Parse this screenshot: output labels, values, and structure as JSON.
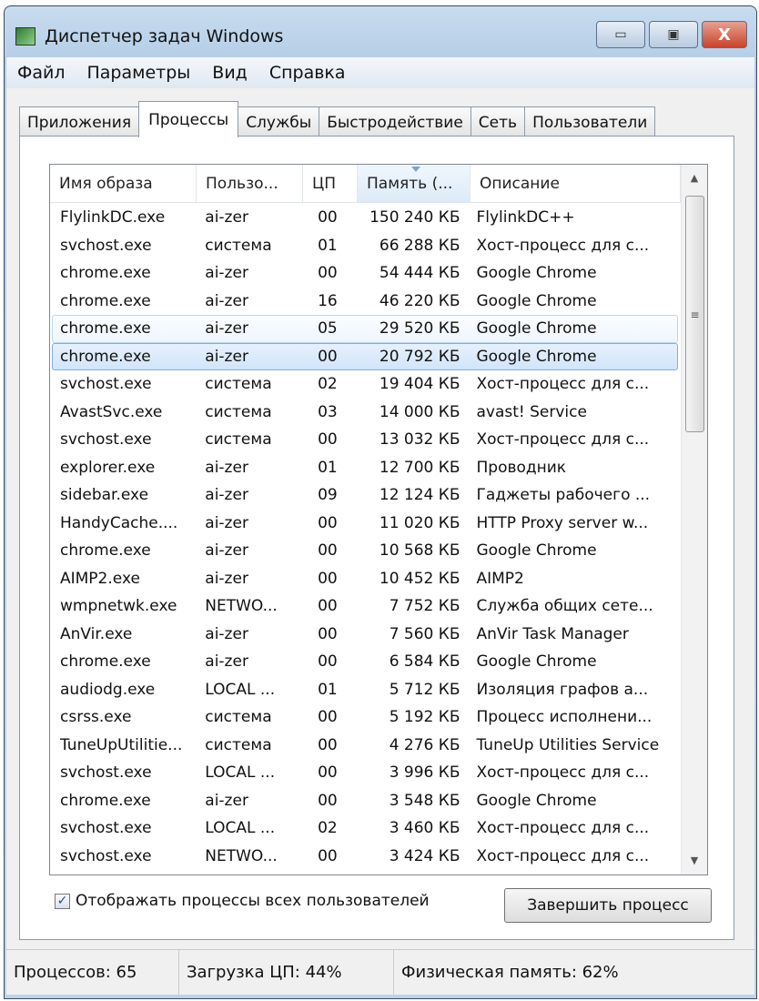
{
  "window": {
    "title": "Диспетчер задач Windows",
    "minimize": "▭",
    "maximize": "▣",
    "close": "X"
  },
  "menu": [
    "Файл",
    "Параметры",
    "Вид",
    "Справка"
  ],
  "tabs": [
    "Приложения",
    "Процессы",
    "Службы",
    "Быстродействие",
    "Сеть",
    "Пользователи"
  ],
  "columns": [
    "Имя образа",
    "Пользо...",
    "ЦП",
    "Память (...",
    "Описание"
  ],
  "rows": [
    [
      "FlylinkDC.exe",
      "ai-zer",
      "00",
      "150 240 КБ",
      "FlylinkDC++"
    ],
    [
      "svchost.exe",
      "система",
      "01",
      "66 288 КБ",
      "Хост-процесс для с..."
    ],
    [
      "chrome.exe",
      "ai-zer",
      "00",
      "54 444 КБ",
      "Google Chrome"
    ],
    [
      "chrome.exe",
      "ai-zer",
      "16",
      "46 220 КБ",
      "Google Chrome"
    ],
    [
      "chrome.exe",
      "ai-zer",
      "05",
      "29 520 КБ",
      "Google Chrome"
    ],
    [
      "chrome.exe",
      "ai-zer",
      "00",
      "20 792 КБ",
      "Google Chrome"
    ],
    [
      "svchost.exe",
      "система",
      "02",
      "19 404 КБ",
      "Хост-процесс для с..."
    ],
    [
      "AvastSvc.exe",
      "система",
      "03",
      "14 000 КБ",
      "avast! Service"
    ],
    [
      "svchost.exe",
      "система",
      "00",
      "13 032 КБ",
      "Хост-процесс для с..."
    ],
    [
      "explorer.exe",
      "ai-zer",
      "01",
      "12 700 КБ",
      "Проводник"
    ],
    [
      "sidebar.exe",
      "ai-zer",
      "09",
      "12 124 КБ",
      "Гаджеты рабочего ..."
    ],
    [
      "HandyCache....",
      "ai-zer",
      "00",
      "11 020 КБ",
      "HTTP Proxy server w..."
    ],
    [
      "chrome.exe",
      "ai-zer",
      "00",
      "10 568 КБ",
      "Google Chrome"
    ],
    [
      "AIMP2.exe",
      "ai-zer",
      "00",
      "10 452 КБ",
      "AIMP2"
    ],
    [
      "wmpnetwk.exe",
      "NETWO...",
      "00",
      "7 752 КБ",
      "Служба общих сете..."
    ],
    [
      "AnVir.exe",
      "ai-zer",
      "00",
      "7 560 КБ",
      "AnVir Task Manager"
    ],
    [
      "chrome.exe",
      "ai-zer",
      "00",
      "6 584 КБ",
      "Google Chrome"
    ],
    [
      "audiodg.exe",
      "LOCAL ...",
      "01",
      "5 712 КБ",
      "Изоляция графов а..."
    ],
    [
      "csrss.exe",
      "система",
      "00",
      "5 192 КБ",
      "Процесс исполнени..."
    ],
    [
      "TuneUpUtilitie...",
      "система",
      "00",
      "4 276 КБ",
      "TuneUp Utilities Service"
    ],
    [
      "svchost.exe",
      "LOCAL ...",
      "00",
      "3 996 КБ",
      "Хост-процесс для с..."
    ],
    [
      "chrome.exe",
      "ai-zer",
      "00",
      "3 548 КБ",
      "Google Chrome"
    ],
    [
      "svchost.exe",
      "LOCAL ...",
      "02",
      "3 460 КБ",
      "Хост-процесс для с..."
    ],
    [
      "svchost.exe",
      "NETWO...",
      "00",
      "3 424 КБ",
      "Хост-процесс для с..."
    ]
  ],
  "show_all_users": {
    "label": "Отображать процессы всех пользователей",
    "checked": true
  },
  "end_process": "Завершить процесс",
  "status": [
    "Процессов: 65",
    "Загрузка ЦП: 44%",
    "Физическая память: 62%"
  ]
}
